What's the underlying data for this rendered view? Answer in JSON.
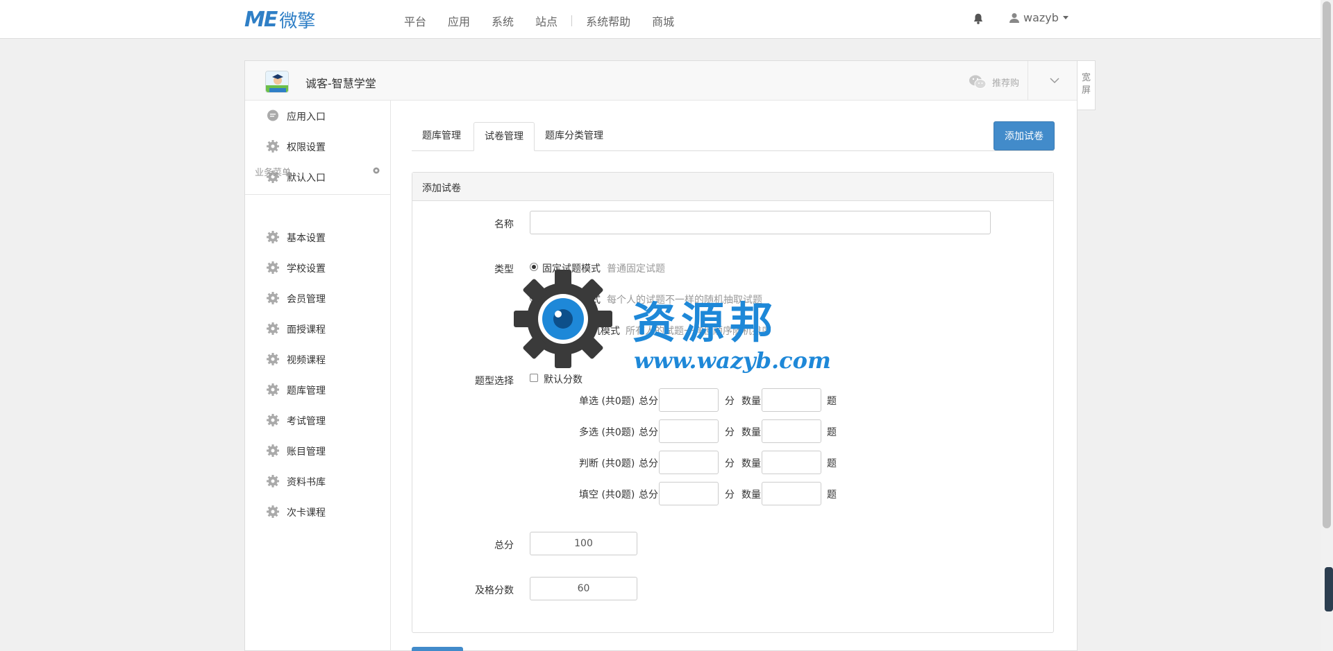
{
  "topbar": {
    "logo_me": "ME",
    "logo_cn": "微擎",
    "nav": [
      "平台",
      "应用",
      "系统",
      "站点",
      "系统帮助",
      "商城"
    ],
    "user": "wazyb"
  },
  "app": {
    "title": "诚客-智慧学堂",
    "recommend": "推荐购",
    "wide_screen": "宽屏"
  },
  "sidebar": {
    "top_items": [
      {
        "label": "应用入口",
        "icon": "chat-icon"
      },
      {
        "label": "权限设置",
        "icon": "gear-icon"
      },
      {
        "label": "默认入口",
        "icon": "gear-icon"
      }
    ],
    "group_title": "业务菜单",
    "group_items": [
      {
        "label": "基本设置"
      },
      {
        "label": "学校设置"
      },
      {
        "label": "会员管理"
      },
      {
        "label": "面授课程"
      },
      {
        "label": "视频课程"
      },
      {
        "label": "题库管理"
      },
      {
        "label": "考试管理"
      },
      {
        "label": "账目管理"
      },
      {
        "label": "资料书库"
      },
      {
        "label": "次卡课程"
      }
    ]
  },
  "tabs": [
    {
      "label": "题库管理",
      "active": false
    },
    {
      "label": "试卷管理",
      "active": true
    },
    {
      "label": "题库分类管理",
      "active": false
    }
  ],
  "add_button": "添加试卷",
  "form": {
    "panel_title": "添加试卷",
    "name_label": "名称",
    "name_value": "",
    "type_label": "类型",
    "types": [
      {
        "label": "固定试题模式",
        "desc": "普通固定试题",
        "checked": true
      },
      {
        "label": "随机试题模式",
        "desc": "每个人的试题不一样的随机抽取试题",
        "checked": false
      },
      {
        "label": "试题顺序随机模式",
        "desc": "所有人的试题一样但顺序随机排序",
        "checked": false
      }
    ],
    "qtype_label": "题型选择",
    "default_score_label": "默认分数",
    "qtypes": [
      {
        "label": "单选 (共0题)",
        "total_label": "总分",
        "unit": "分",
        "count_label": "数量",
        "count_unit": "题"
      },
      {
        "label": "多选 (共0题)",
        "total_label": "总分",
        "unit": "分",
        "count_label": "数量",
        "count_unit": "题"
      },
      {
        "label": "判断 (共0题)",
        "total_label": "总分",
        "unit": "分",
        "count_label": "数量",
        "count_unit": "题"
      },
      {
        "label": "填空 (共0题)",
        "total_label": "总分",
        "unit": "分",
        "count_label": "数量",
        "count_unit": "题"
      }
    ],
    "total_label": "总分",
    "total_value": "100",
    "pass_label": "及格分数",
    "pass_value": "60"
  },
  "watermark": {
    "title": "资源邦",
    "url": "www.wazyb.com"
  },
  "colors": {
    "brand": "#2f7fc6",
    "primary_button": "#428bca",
    "watermark": "#1e88d8"
  }
}
